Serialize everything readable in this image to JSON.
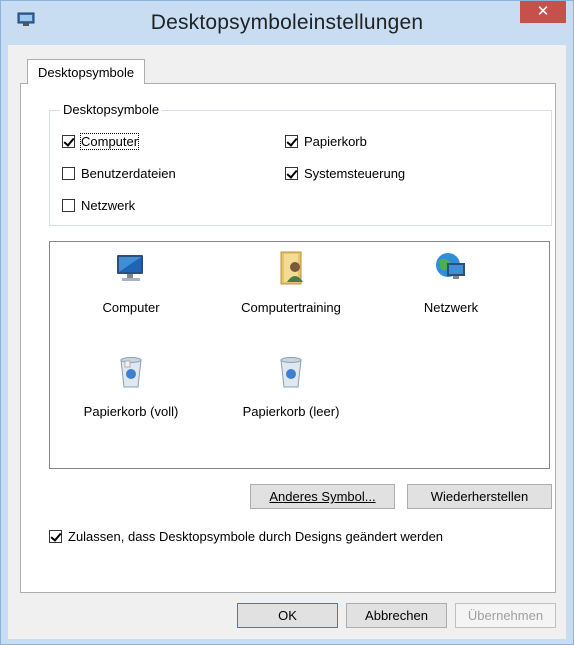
{
  "window": {
    "title": "Desktopsymboleinstellungen",
    "close_label": "✕"
  },
  "tab": {
    "label": "Desktopsymbole"
  },
  "group": {
    "title": "Desktopsymbole",
    "checkboxes": [
      {
        "label": "Computer",
        "checked": true
      },
      {
        "label": "Benutzerdateien",
        "checked": false
      },
      {
        "label": "Netzwerk",
        "checked": false
      },
      {
        "label": "Papierkorb",
        "checked": true
      },
      {
        "label": "Systemsteuerung",
        "checked": true
      }
    ]
  },
  "icons": [
    {
      "label": "Computer",
      "icon": "computer-icon"
    },
    {
      "label": "Computertraining",
      "icon": "user-folder-icon"
    },
    {
      "label": "Netzwerk",
      "icon": "network-icon"
    },
    {
      "label": "Papierkorb (voll)",
      "icon": "recycle-bin-full-icon"
    },
    {
      "label": "Papierkorb (leer)",
      "icon": "recycle-bin-empty-icon"
    }
  ],
  "buttons": {
    "change_icon": "Anderes Symbol...",
    "restore": "Wiederherstellen",
    "ok": "OK",
    "cancel": "Abbrechen",
    "apply": "Übernehmen"
  },
  "allow_themes": {
    "label": "Zulassen, dass Desktopsymbole durch Designs geändert werden",
    "checked": true
  },
  "colors": {
    "titlebar": "#c8ddf2",
    "close": "#c7504c",
    "panel": "#ffffff",
    "frame": "#f0f0f0"
  }
}
